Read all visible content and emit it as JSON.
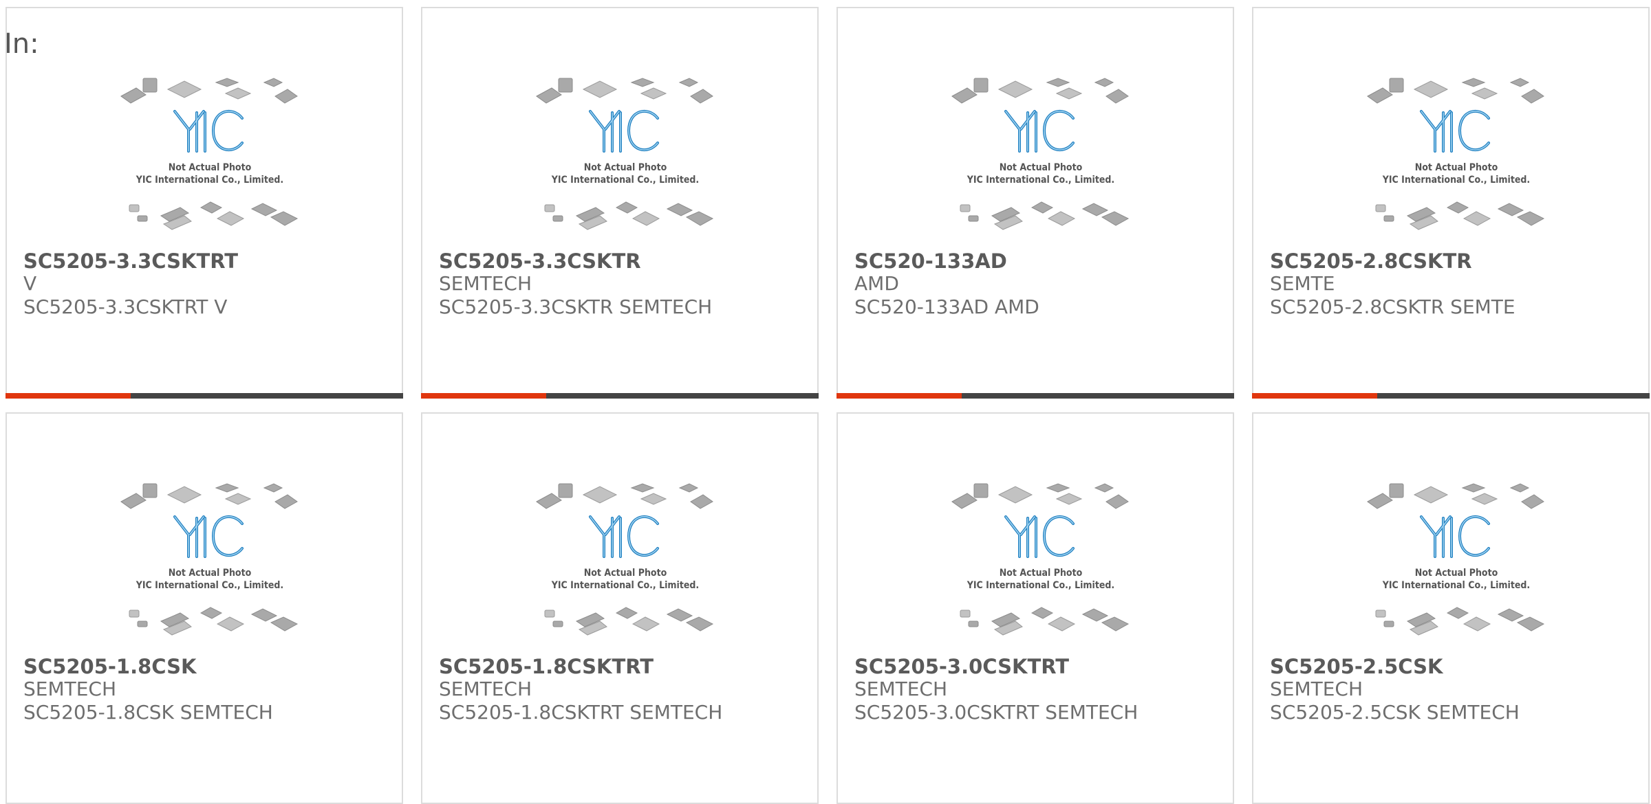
{
  "header": {
    "prefix": "In:"
  },
  "theme": {
    "accent": "#e0360e",
    "bar": "#444444",
    "border": "#dcdcdc"
  },
  "thumbnail": {
    "icon": "yic-logo-icon",
    "caption_line1": "Not Actual Photo",
    "caption_line2": "YIC International Co., Limited."
  },
  "products": [
    {
      "part": "SC5205-3.3CSKTRT",
      "maker": "V",
      "desc": "SC5205-3.3CSKTRT V"
    },
    {
      "part": "SC5205-3.3CSKTR",
      "maker": "SEMTECH",
      "desc": "SC5205-3.3CSKTR SEMTECH"
    },
    {
      "part": "SC520-133AD",
      "maker": "AMD",
      "desc": "SC520-133AD AMD"
    },
    {
      "part": "SC5205-2.8CSKTR",
      "maker": "SEMTE",
      "desc": "SC5205-2.8CSKTR SEMTE"
    },
    {
      "part": "SC5205-1.8CSK",
      "maker": "SEMTECH",
      "desc": "SC5205-1.8CSK SEMTECH"
    },
    {
      "part": "SC5205-1.8CSKTRT",
      "maker": "SEMTECH",
      "desc": "SC5205-1.8CSKTRT SEMTECH"
    },
    {
      "part": "SC5205-3.0CSKTRT",
      "maker": "SEMTECH",
      "desc": "SC5205-3.0CSKTRT SEMTECH"
    },
    {
      "part": "SC5205-2.5CSK",
      "maker": "SEMTECH",
      "desc": "SC5205-2.5CSK SEMTECH"
    }
  ]
}
